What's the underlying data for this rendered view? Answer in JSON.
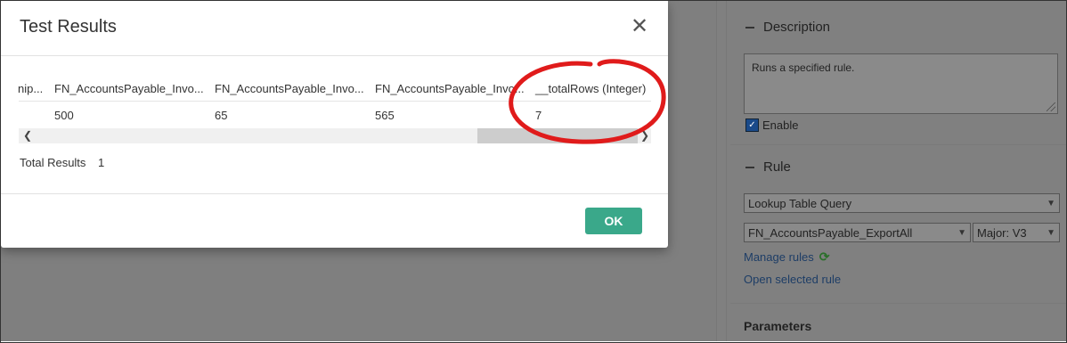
{
  "modal": {
    "title": "Test Results",
    "columns": [
      "nip...",
      "FN_AccountsPayable_Invo...",
      "FN_AccountsPayable_Invo...",
      "FN_AccountsPayable_Invo...",
      "__totalRows (Integer)"
    ],
    "row": [
      "",
      "500",
      "65",
      "565",
      "7"
    ],
    "total_label": "Total Results",
    "total_value": "1",
    "ok_label": "OK"
  },
  "right_panel": {
    "description_header": "Description",
    "description_text": "Runs a specified rule.",
    "enable_label": "Enable",
    "rule_header": "Rule",
    "rule_type": "Lookup Table Query",
    "rule_name": "FN_AccountsPayable_ExportAll",
    "rule_version": "Major: V3",
    "manage_rules": "Manage rules",
    "open_selected_rule": "Open selected rule",
    "parameters_header": "Parameters"
  },
  "colors": {
    "ok_button": "#3aa88a",
    "annotation": "#e01b1b",
    "overlay": "#7f7f7f",
    "link": "#1d3d66"
  },
  "icons": [
    "close-icon",
    "scroll-left-icon",
    "scroll-right-icon",
    "minus-icon",
    "checkbox-checked-icon",
    "chevron-down-icon",
    "refresh-icon"
  ]
}
